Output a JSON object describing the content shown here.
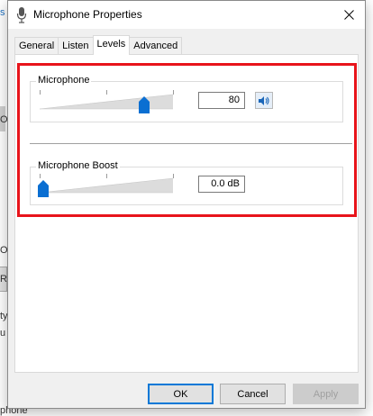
{
  "background_window": {
    "fragment_top": "s",
    "fragment_1": "Ou",
    "fragment_2": "Re",
    "fragment_3": "ty",
    "fragment_4": "u",
    "fragment_bottom": "phone"
  },
  "dialog": {
    "title": "Microphone Properties",
    "close_glyph": "✕",
    "tabs": [
      {
        "label": "General",
        "active": false
      },
      {
        "label": "Listen",
        "active": false
      },
      {
        "label": "Levels",
        "active": true
      },
      {
        "label": "Advanced",
        "active": false
      }
    ],
    "levels": {
      "microphone": {
        "label": "Microphone",
        "value_text": "80",
        "level": 80,
        "max": 100,
        "mute_icon": "speaker-icon"
      },
      "boost": {
        "label": "Microphone Boost",
        "value_text": "0.0 dB",
        "level": 0,
        "max": 30
      }
    },
    "buttons": {
      "ok": "OK",
      "cancel": "Cancel",
      "apply": "Apply"
    }
  },
  "colors": {
    "accent": "#0078d7",
    "highlight_box": "#e8141b"
  }
}
